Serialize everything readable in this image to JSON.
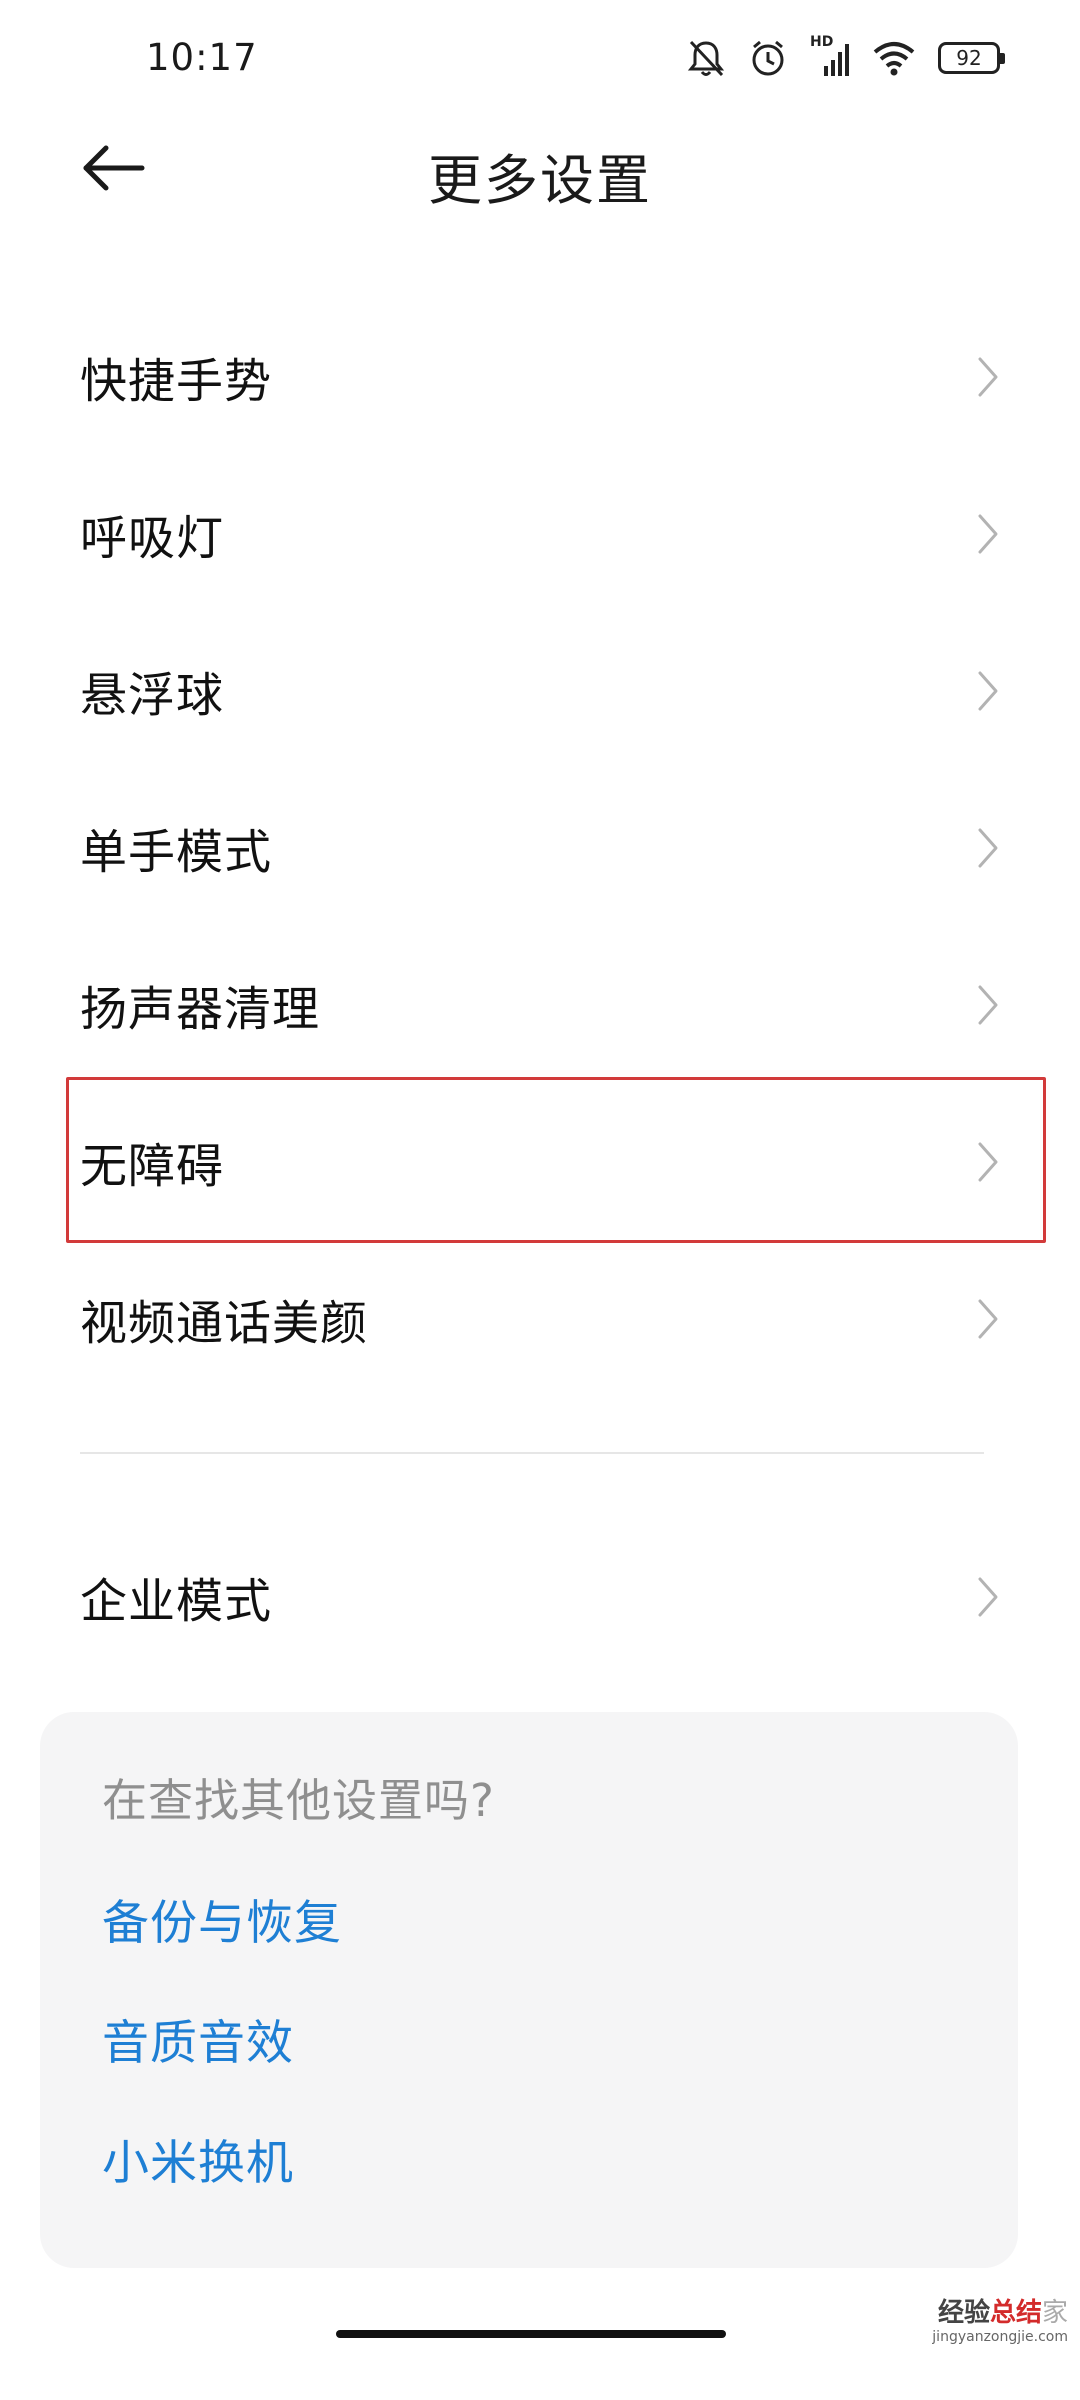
{
  "status_bar": {
    "time": "10:17",
    "hd_label": "HD",
    "battery": "92",
    "icons": [
      "mute-bell-icon",
      "alarm-icon",
      "signal-icon",
      "wifi-icon",
      "battery-icon"
    ]
  },
  "header": {
    "title": "更多设置",
    "back_icon": "arrow-left-icon"
  },
  "menu": {
    "items": [
      {
        "label": "快捷手势"
      },
      {
        "label": "呼吸灯"
      },
      {
        "label": "悬浮球"
      },
      {
        "label": "单手模式"
      },
      {
        "label": "扬声器清理"
      },
      {
        "label": "无障碍"
      },
      {
        "label": "视频通话美颜"
      },
      {
        "label": "企业模式"
      }
    ]
  },
  "suggestions": {
    "title": "在查找其他设置吗?",
    "links": [
      {
        "label": "备份与恢复"
      },
      {
        "label": "音质音效"
      },
      {
        "label": "小米换机"
      }
    ]
  },
  "watermark": {
    "main_left": "经验",
    "main_right": "总结",
    "main_tail": "家",
    "sub": "jingyanzongjie.com"
  },
  "colors": {
    "accent_blue": "#1e7fd4",
    "highlight_red": "#d23a3a",
    "card_bg": "#f5f5f6"
  }
}
